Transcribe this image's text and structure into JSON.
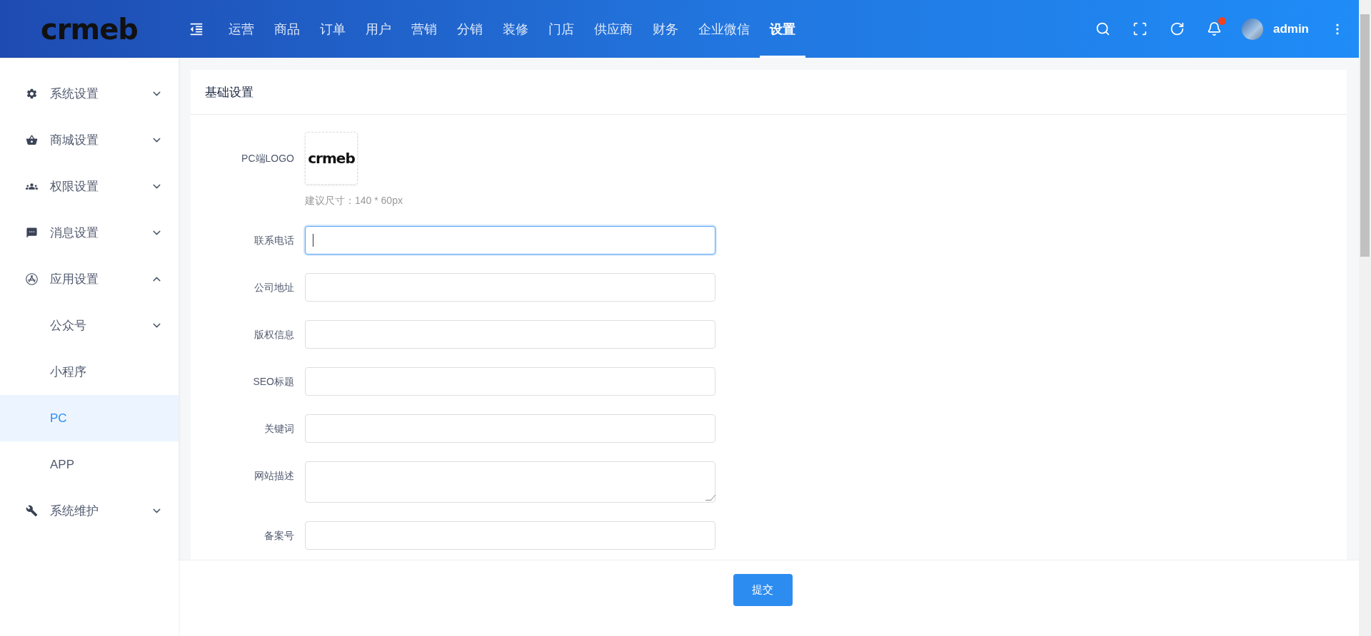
{
  "header": {
    "logo": "crmeb",
    "nav": [
      {
        "label": "运营",
        "selected": false
      },
      {
        "label": "商品",
        "selected": false
      },
      {
        "label": "订单",
        "selected": false
      },
      {
        "label": "用户",
        "selected": false
      },
      {
        "label": "营销",
        "selected": false
      },
      {
        "label": "分销",
        "selected": false
      },
      {
        "label": "装修",
        "selected": false
      },
      {
        "label": "门店",
        "selected": false
      },
      {
        "label": "供应商",
        "selected": false
      },
      {
        "label": "财务",
        "selected": false
      },
      {
        "label": "企业微信",
        "selected": false
      },
      {
        "label": "设置",
        "selected": true
      }
    ],
    "notification_dot": true,
    "user": "admin"
  },
  "sidebar": {
    "items": [
      {
        "label": "系统设置",
        "expanded": false,
        "selected": false
      },
      {
        "label": "商城设置",
        "expanded": false,
        "selected": false
      },
      {
        "label": "权限设置",
        "expanded": false,
        "selected": false
      },
      {
        "label": "消息设置",
        "expanded": false,
        "selected": false
      },
      {
        "label": "应用设置",
        "expanded": true,
        "selected": false,
        "children": [
          {
            "label": "公众号",
            "kind": "group",
            "expanded": false,
            "selected": false
          },
          {
            "label": "小程序",
            "kind": "link",
            "selected": false
          },
          {
            "label": "PC",
            "kind": "link",
            "selected": true
          },
          {
            "label": "APP",
            "kind": "link",
            "selected": false
          }
        ]
      },
      {
        "label": "系统维护",
        "expanded": false,
        "selected": false
      }
    ]
  },
  "card": {
    "title": "基础设置",
    "fields": [
      {
        "kind": "image",
        "label": "PC端LOGO",
        "image_text": "crmeb",
        "hint": "建议尺寸：140 * 60px"
      },
      {
        "kind": "input",
        "label": "联系电话",
        "focused": true
      },
      {
        "kind": "input",
        "label": "公司地址",
        "focused": false
      },
      {
        "kind": "input",
        "label": "版权信息",
        "focused": false
      },
      {
        "kind": "input",
        "label": "SEO标题",
        "focused": false
      },
      {
        "kind": "input",
        "label": "关键词",
        "focused": false
      },
      {
        "kind": "textarea",
        "label": "网站描述",
        "focused": false
      },
      {
        "kind": "input",
        "label": "备案号",
        "focused": false
      }
    ]
  },
  "footer": {
    "submit": "提交"
  }
}
